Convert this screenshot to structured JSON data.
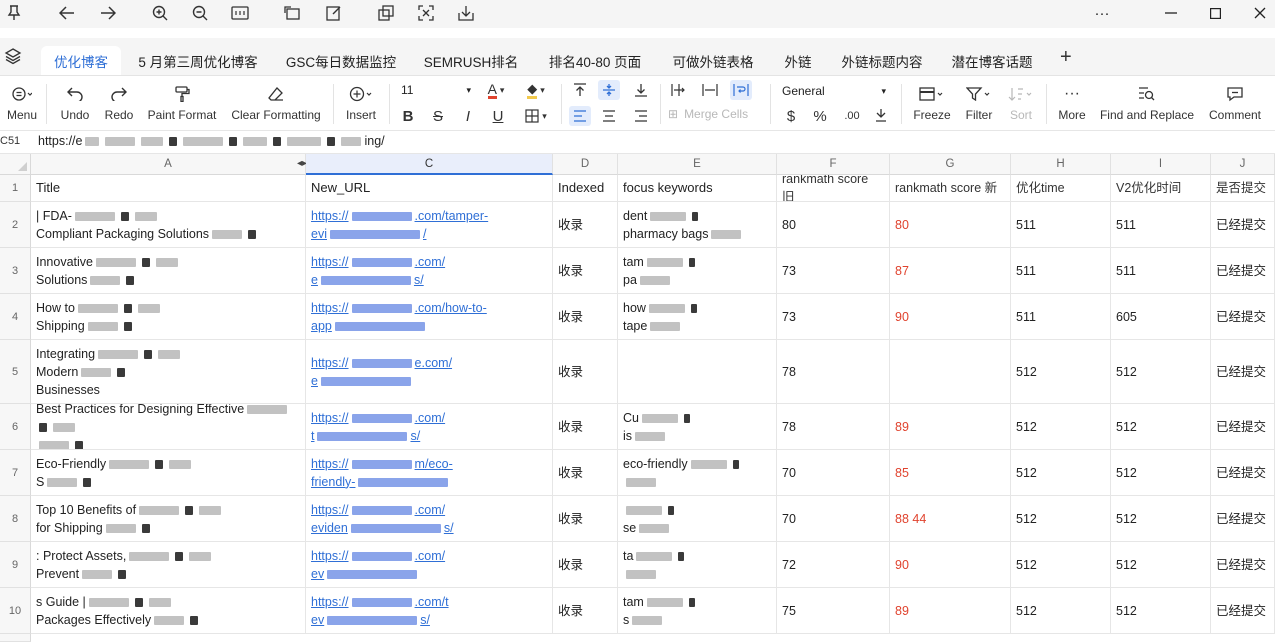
{
  "titlebar": {
    "left_icons": [
      "pin-icon",
      "back-arrow-icon",
      "forward-arrow-icon",
      "zoom-in-icon",
      "zoom-out-icon",
      "fit-width-icon",
      "rotate-icon",
      "edit-icon",
      "copy-window-icon",
      "fullscreen-icon",
      "download-icon"
    ],
    "window_controls": [
      "more-icon",
      "minimize-icon",
      "maximize-icon",
      "close-icon"
    ]
  },
  "tabs": [
    {
      "label": "优化博客",
      "active": true
    },
    {
      "label": "5 月第三周优化博客"
    },
    {
      "label": "GSC每日数据监控"
    },
    {
      "label": "SEMRUSH排名"
    },
    {
      "label": "排名40-80 页面"
    },
    {
      "label": "可做外链表格"
    },
    {
      "label": "外链"
    },
    {
      "label": "外链标题内容"
    },
    {
      "label": "潜在博客话题"
    }
  ],
  "toolbar": {
    "menu": "Menu",
    "undo": "Undo",
    "redo": "Redo",
    "paint_format": "Paint Format",
    "clear_formatting": "Clear Formatting",
    "insert": "Insert",
    "font_size": "11",
    "merge_cells": "Merge Cells",
    "number_format": "General",
    "currency": "$",
    "percent": "%",
    "decrease_decimal": ".00",
    "freeze": "Freeze",
    "filter": "Filter",
    "sort": "Sort",
    "more": "More",
    "find_replace": "Find and Replace",
    "comment": "Comment",
    "accent_color": "#2f6fd6",
    "font_color_bar": "#e0432e",
    "fill_color_bar": "#f2c94c"
  },
  "formula_bar": {
    "cell_ref": "C51",
    "prefix": "https://e",
    "suffix": "ing/"
  },
  "columns": [
    {
      "letter": "A"
    },
    {
      "letter": "C",
      "selected": true
    },
    {
      "letter": "D"
    },
    {
      "letter": "E"
    },
    {
      "letter": "F"
    },
    {
      "letter": "G"
    },
    {
      "letter": "H"
    },
    {
      "letter": "I"
    },
    {
      "letter": "J"
    }
  ],
  "header_row": {
    "num": "1",
    "title": "Title",
    "new_url": "New_URL",
    "indexed": "Indexed",
    "focus": "focus keywords",
    "score_old": "rankmath score 旧",
    "score_new": "rankmath score 新",
    "opt_time": "优化time",
    "v2_time": "V2优化时间",
    "submitted": "是否提交"
  },
  "rows": [
    {
      "num": "2",
      "title_a": "| FDA-",
      "title_b": "Compliant Packaging Solutions",
      "url_a": "https://",
      "url_mid": ".com/tamper-",
      "url_b": "evi",
      "url_end": "/",
      "indexed": "收录",
      "focus_a": "dent",
      "focus_b": "pharmacy bags",
      "score_old": "80",
      "score_new": "80",
      "opt_time": "511",
      "v2_time": "511",
      "submitted": "已经提交"
    },
    {
      "num": "3",
      "title_a": "Innovative",
      "title_b": "Solutions",
      "url_a": "https://",
      "url_mid": ".com/",
      "url_b": "e",
      "url_end": "s/",
      "indexed": "收录",
      "focus_a": "tam",
      "focus_b": "pa",
      "score_old": "73",
      "score_new": "87",
      "opt_time": "511",
      "v2_time": "511",
      "submitted": "已经提交"
    },
    {
      "num": "4",
      "title_a": "How to",
      "title_b": "Shipping",
      "url_a": "https://",
      "url_mid": ".com/how-to-",
      "url_b": "app",
      "url_end": "",
      "indexed": "收录",
      "focus_a": "how",
      "focus_b": "tape",
      "score_old": "73",
      "score_new": "90",
      "opt_time": "511",
      "v2_time": "605",
      "submitted": "已经提交"
    },
    {
      "num": "5",
      "title_a": "Integrating",
      "title_b": "Modern",
      "title_c": "Businesses",
      "url_a": "https://",
      "url_mid": "e.com/",
      "url_b": "e",
      "url_end": "",
      "indexed": "收录",
      "focus_a": "",
      "focus_b": "",
      "score_old": "78",
      "score_new": "",
      "opt_time": "512",
      "v2_time": "512",
      "submitted": "已经提交"
    },
    {
      "num": "6",
      "title_a": "Best Practices for Designing Effective",
      "title_b": "",
      "url_a": "https://",
      "url_mid": ".com/",
      "url_b": "t",
      "url_end": "s/",
      "indexed": "收录",
      "focus_a": "Cu",
      "focus_b": "is",
      "score_old": "78",
      "score_new": "89",
      "opt_time": "512",
      "v2_time": "512",
      "submitted": "已经提交"
    },
    {
      "num": "7",
      "title_a": "Eco-Friendly",
      "title_b": "S",
      "url_a": "https://",
      "url_mid": "m/eco-",
      "url_b": "friendly-",
      "url_end": "",
      "indexed": "收录",
      "focus_a": "eco-friendly",
      "focus_b": "",
      "score_old": "70",
      "score_new": "85",
      "opt_time": "512",
      "v2_time": "512",
      "submitted": "已经提交"
    },
    {
      "num": "8",
      "title_a": "Top 10 Benefits of",
      "title_b": "for Shipping",
      "url_a": "https://",
      "url_mid": ".com/",
      "url_b": "eviden",
      "url_end": "s/",
      "indexed": "收录",
      "focus_a": "",
      "focus_b": "se",
      "score_old": "70",
      "score_new": "88 44",
      "opt_time": "512",
      "v2_time": "512",
      "submitted": "已经提交"
    },
    {
      "num": "9",
      "title_a": ": Protect Assets,",
      "title_b": "Prevent",
      "url_a": "https://",
      "url_mid": ".com/",
      "url_b": "ev",
      "url_end": "",
      "indexed": "收录",
      "focus_a": "ta",
      "focus_b": "",
      "score_old": "72",
      "score_new": "90",
      "opt_time": "512",
      "v2_time": "512",
      "submitted": "已经提交"
    },
    {
      "num": "10",
      "title_a": "s Guide |",
      "title_b": "Packages Effectively",
      "url_a": "https://",
      "url_mid": ".com/t",
      "url_b": "ev",
      "url_end": "s/",
      "indexed": "收录",
      "focus_a": "tam",
      "focus_b": "s",
      "score_old": "75",
      "score_new": "89",
      "opt_time": "512",
      "v2_time": "512",
      "submitted": "已经提交"
    }
  ]
}
